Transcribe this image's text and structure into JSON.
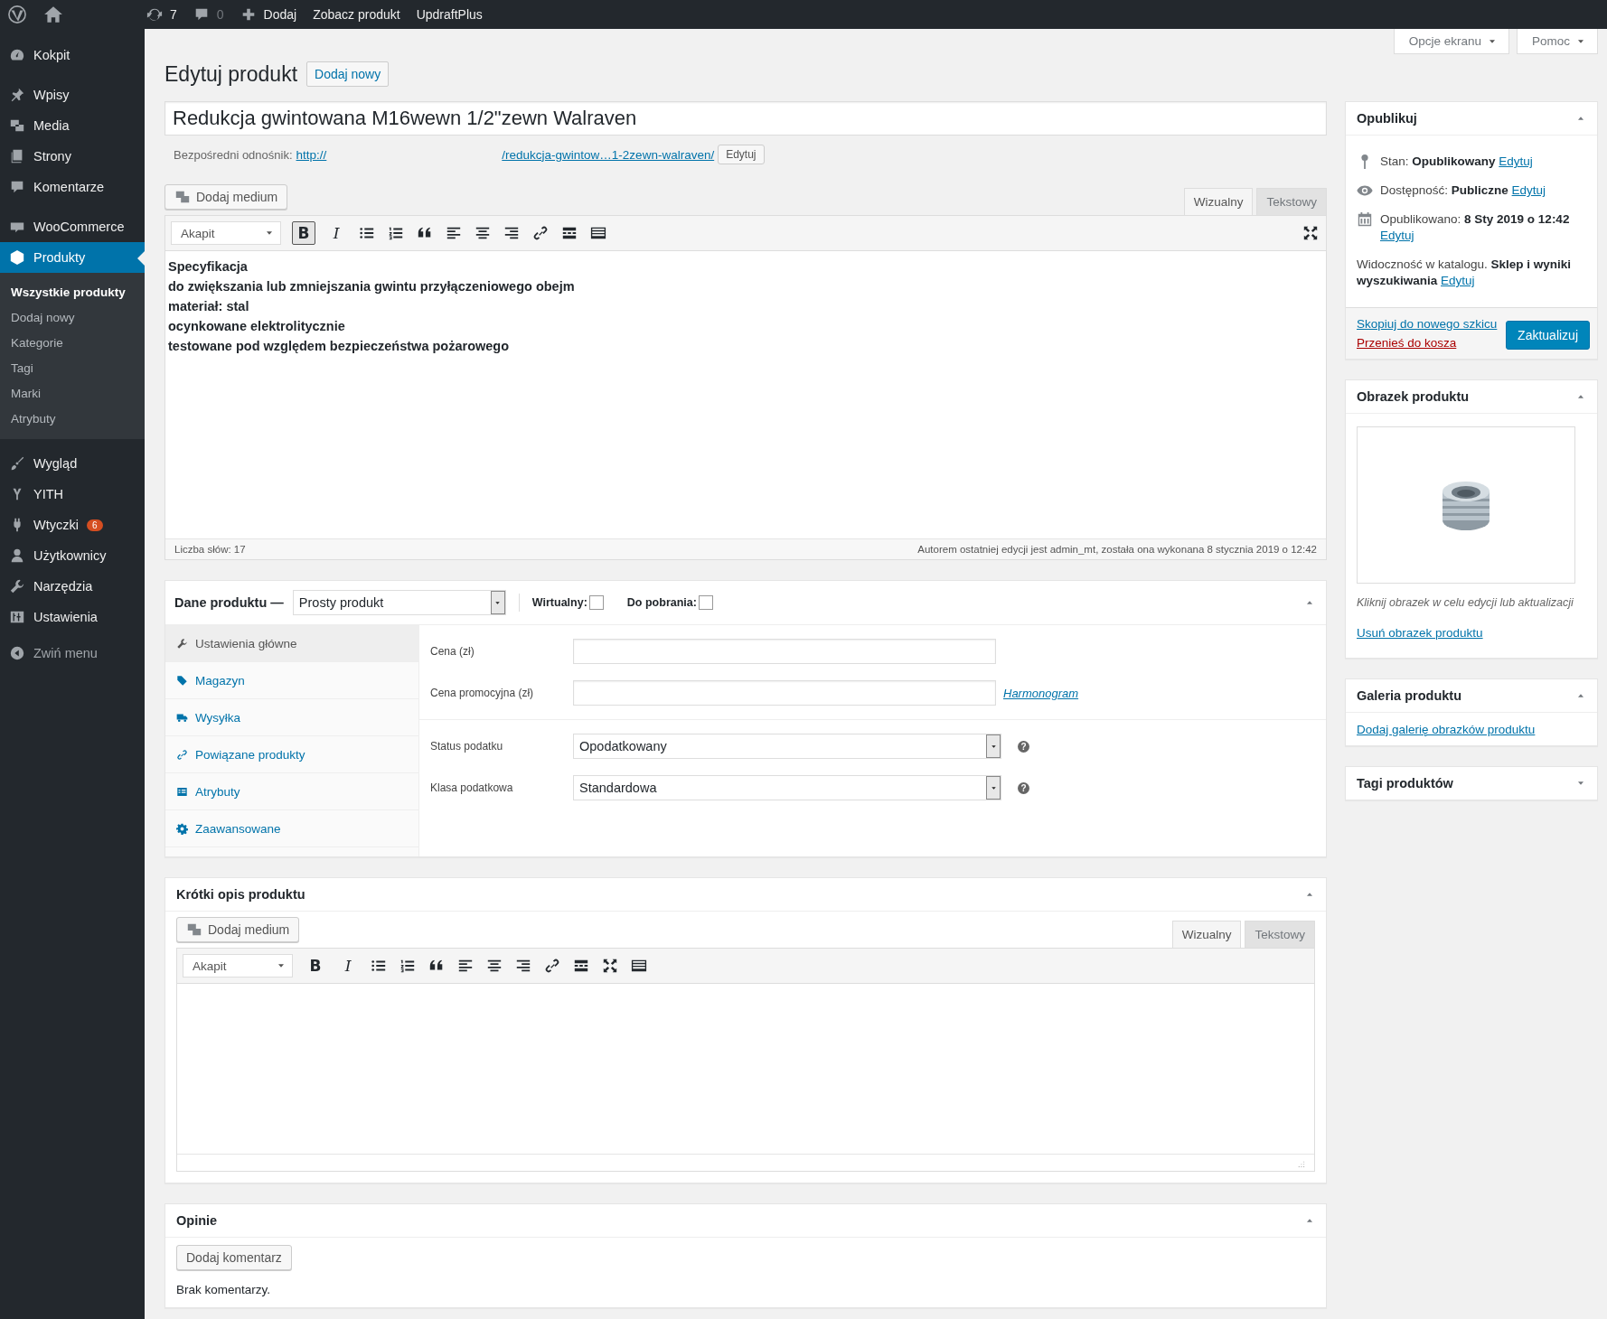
{
  "admin_bar": {
    "updates": "7",
    "comments": "0",
    "new_label": "Dodaj",
    "view_label": "Zobacz produkt",
    "plugin_label": "UpdraftPlus"
  },
  "screen_buttons": [
    {
      "label": "Opcje ekranu"
    },
    {
      "label": "Pomoc"
    }
  ],
  "sidebar": {
    "groups": [
      [
        {
          "kind": "dashboard",
          "label": "Kokpit",
          "selected": false
        }
      ],
      [
        {
          "kind": "posts",
          "label": "Wpisy",
          "selected": false
        },
        {
          "kind": "media",
          "label": "Media",
          "selected": false
        },
        {
          "kind": "pages",
          "label": "Strony",
          "selected": false
        },
        {
          "kind": "comments",
          "label": "Komentarze",
          "selected": false
        }
      ],
      [
        {
          "kind": "woo",
          "label": "WooCommerce",
          "selected": false
        },
        {
          "kind": "products",
          "label": "Produkty",
          "selected": true,
          "children": [
            {
              "label": "Wszystkie produkty",
              "selected": true
            },
            {
              "label": "Dodaj nowy",
              "selected": false
            },
            {
              "label": "Kategorie",
              "selected": false
            },
            {
              "label": "Tagi",
              "selected": false
            },
            {
              "label": "Marki",
              "selected": false
            },
            {
              "label": "Atrybuty",
              "selected": false
            }
          ]
        }
      ],
      [
        {
          "kind": "appearance",
          "label": "Wygląd",
          "selected": false
        },
        {
          "kind": "yith",
          "label": "YITH",
          "selected": false
        },
        {
          "kind": "plugins",
          "label": "Wtyczki",
          "selected": false,
          "badge": "6"
        },
        {
          "kind": "users",
          "label": "Użytkownicy",
          "selected": false
        },
        {
          "kind": "tools",
          "label": "Narzędzia",
          "selected": false
        },
        {
          "kind": "settings",
          "label": "Ustawienia",
          "selected": false
        }
      ]
    ],
    "collapse_label": "Zwiń menu"
  },
  "page": {
    "title": "Edytuj produkt",
    "add_new": "Dodaj nowy"
  },
  "product_title": "Redukcja gwintowana M16wewn 1/2\"zewn Walraven",
  "permalink": {
    "label": "Bezpośredni odnośnik:",
    "start": "http://",
    "end": "/redukcja-gwintow…1-2zewn-walraven/",
    "button": "Edytuj"
  },
  "editor": {
    "media_button": "Dodaj medium",
    "tabs": [
      {
        "label": "Wizualny",
        "selected": true
      },
      {
        "label": "Tekstowy",
        "selected": false
      }
    ],
    "format": "Akapit",
    "toolbar": [
      {
        "kind": "bold",
        "glyph": "B",
        "active": true
      },
      {
        "kind": "italic",
        "glyph": "I",
        "active": false
      },
      {
        "kind": "ul"
      },
      {
        "kind": "ol"
      },
      {
        "kind": "quote"
      },
      {
        "kind": "align-left"
      },
      {
        "kind": "align-center"
      },
      {
        "kind": "align-right"
      },
      {
        "kind": "link"
      },
      {
        "kind": "more"
      },
      {
        "kind": "kitchen"
      }
    ],
    "content": [
      "Specyfikacja",
      "do zwiększania lub zmniejszania gwintu przyłączeniowego obejm",
      "materiał: stal",
      "ocynkowane elektrolitycznie",
      "testowane pod względem bezpieczeństwa pożarowego"
    ],
    "word_count": "Liczba słów: 17",
    "last_edit": "Autorem ostatniej edycji jest admin_mt, została ona wykonana 8 stycznia 2019 o 12:42"
  },
  "product_data": {
    "title": "Dane produktu —",
    "type": "Prosty produkt",
    "expanded": true,
    "options": [
      {
        "label": "Wirtualny:",
        "checked": false
      },
      {
        "label": "Do pobrania:",
        "checked": false
      }
    ],
    "tabs": [
      {
        "kind": "general",
        "label": "Ustawienia główne",
        "selected": true
      },
      {
        "kind": "inventory",
        "label": "Magazyn",
        "selected": false
      },
      {
        "kind": "shipping",
        "label": "Wysyłka",
        "selected": false
      },
      {
        "kind": "linked",
        "label": "Powiązane produkty",
        "selected": false
      },
      {
        "kind": "attributes",
        "label": "Atrybuty",
        "selected": false
      },
      {
        "kind": "advanced",
        "label": "Zaawansowane",
        "selected": false
      }
    ],
    "groups": [
      [
        {
          "kind": "input",
          "label": "Cena (zł)"
        },
        {
          "kind": "input",
          "label": "Cena promocyjna (zł)",
          "link": "Harmonogram"
        }
      ],
      [
        {
          "kind": "select",
          "label": "Status podatku",
          "value": "Opodatkowany",
          "help": "?"
        },
        {
          "kind": "select",
          "label": "Klasa podatkowa",
          "value": "Standardowa",
          "help": "?"
        }
      ]
    ]
  },
  "short_description": {
    "title": "Krótki opis produktu",
    "expanded": true,
    "media_button": "Dodaj medium",
    "tabs": [
      {
        "label": "Wizualny",
        "selected": true
      },
      {
        "label": "Tekstowy",
        "selected": false
      }
    ],
    "format": "Akapit",
    "toolbar": [
      {
        "kind": "bold",
        "glyph": "B",
        "active": false
      },
      {
        "kind": "italic",
        "glyph": "I",
        "active": false
      },
      {
        "kind": "ul"
      },
      {
        "kind": "ol"
      },
      {
        "kind": "quote"
      },
      {
        "kind": "align-left"
      },
      {
        "kind": "align-center"
      },
      {
        "kind": "align-right"
      },
      {
        "kind": "link"
      },
      {
        "kind": "more"
      },
      {
        "kind": "fullscreen"
      },
      {
        "kind": "kitchen"
      }
    ]
  },
  "reviews": {
    "title": "Opinie",
    "expanded": true,
    "button": "Dodaj komentarz",
    "empty": "Brak komentarzy."
  },
  "publish": {
    "title": "Opublikuj",
    "expanded": true,
    "rows": [
      {
        "kind": "status",
        "text": "Stan: **Opublikowany**",
        "link": "Edytuj"
      },
      {
        "kind": "visibility",
        "text": "Dostępność: **Publiczne**",
        "link": "Edytuj"
      },
      {
        "kind": "date",
        "text": "Opublikowano: **8 Sty 2019 o 12:42**",
        "link": "Edytuj"
      },
      {
        "kind": "catalog",
        "text": "Widoczność w katalogu. **Sklep i wyniki wyszukiwania**",
        "link": "Edytuj"
      }
    ],
    "copy_link": "Skopiuj do nowego szkicu",
    "trash_link": "Przenieś do kosza",
    "update": "Zaktualizuj"
  },
  "product_image": {
    "title": "Obrazek produktu",
    "expanded": true,
    "caption": "Kliknij obrazek w celu edycji lub aktualizacji",
    "remove": "Usuń obrazek produktu"
  },
  "gallery": {
    "title": "Galeria produktu",
    "expanded": true,
    "add": "Dodaj galerię obrazków produktu"
  },
  "tags": {
    "title": "Tagi produktów",
    "expanded": false
  }
}
